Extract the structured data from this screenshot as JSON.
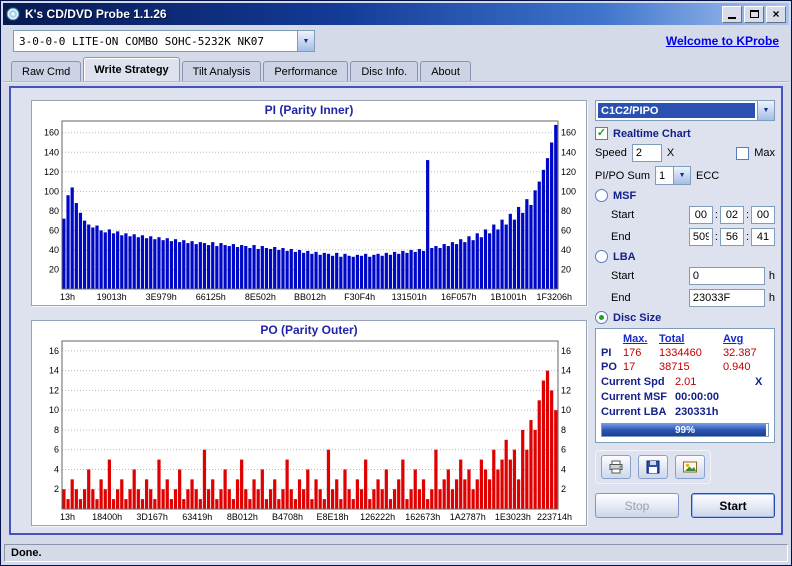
{
  "window": {
    "title": "K's CD/DVD Probe 1.1.26",
    "status": "Done."
  },
  "icons": {
    "dropdown": "▼",
    "check": "✓",
    "close": "×"
  },
  "toolbar": {
    "drive": "3-0-0-0 LITE-ON COMBO SOHC-5232K NK07",
    "link": "Welcome to KProbe"
  },
  "tabs": {
    "items": [
      "Raw Cmd",
      "Write Strategy",
      "Tilt Analysis",
      "Performance",
      "Disc Info.",
      "About"
    ],
    "active_index": 1
  },
  "controls": {
    "mode_combo": "C1C2/PIPO",
    "realtime_label": "Realtime Chart",
    "speed_label": "Speed",
    "speed_value": "2",
    "speed_unit": "X",
    "max_label": "Max",
    "sum_label": "PI/PO Sum",
    "sum_value": "1",
    "ecc_label": "ECC",
    "msf_label": "MSF",
    "lba_label": "LBA",
    "disc_label": "Disc Size",
    "start_label": "Start",
    "end_label": "End",
    "time_sep": ":",
    "msf_start": [
      "00",
      "02",
      "00"
    ],
    "msf_end": [
      "509",
      "56",
      "41"
    ],
    "lba_start": "0",
    "lba_end": "23033F",
    "lba_unit": "h",
    "states": {
      "realtime": true,
      "max": false,
      "range": "disc"
    },
    "stats": {
      "headers": [
        "Max.",
        "Total",
        "Avg"
      ],
      "rows": [
        {
          "label": "PI",
          "max": "176",
          "total": "1334460",
          "avg": "32.387"
        },
        {
          "label": "PO",
          "max": "17",
          "total": "38715",
          "avg": "0.940"
        }
      ]
    },
    "current": [
      {
        "label": "Current Spd",
        "value": "2.01",
        "suffix": "X"
      },
      {
        "label": "Current MSF",
        "value": "00:00:00",
        "suffix": ""
      },
      {
        "label": "Current LBA",
        "value": "230331h",
        "suffix": ""
      }
    ],
    "progress": {
      "percent": 99,
      "label": "99%"
    },
    "stop_label": "Stop"
  },
  "chart_data": [
    {
      "type": "bar",
      "title": "PI (Parity Inner)",
      "color": "#0008c8",
      "ylim": [
        0,
        172
      ],
      "ytick": 20,
      "grid": "dashed-horizontal",
      "x_tick_labels": [
        "13h",
        "19013h",
        "3E979h",
        "66125h",
        "8E502h",
        "BB012h",
        "F30F4h",
        "131501h",
        "16F057h",
        "1B1001h",
        "1F3206h"
      ],
      "values": [
        72,
        96,
        104,
        88,
        78,
        70,
        66,
        63,
        65,
        60,
        58,
        61,
        57,
        59,
        55,
        57,
        54,
        56,
        53,
        55,
        52,
        54,
        51,
        53,
        50,
        52,
        49,
        51,
        48,
        50,
        47,
        49,
        46,
        48,
        47,
        45,
        48,
        44,
        47,
        45,
        44,
        46,
        43,
        45,
        44,
        42,
        45,
        41,
        44,
        42,
        41,
        43,
        40,
        42,
        39,
        41,
        38,
        40,
        37,
        39,
        36,
        38,
        35,
        37,
        36,
        34,
        37,
        33,
        36,
        34,
        33,
        35,
        34,
        36,
        33,
        35,
        36,
        34,
        37,
        35,
        38,
        36,
        39,
        37,
        40,
        38,
        41,
        39,
        132,
        42,
        44,
        42,
        46,
        44,
        48,
        46,
        51,
        48,
        54,
        50,
        57,
        53,
        61,
        57,
        66,
        61,
        71,
        66,
        77,
        71,
        84,
        78,
        92,
        86,
        101,
        110,
        122,
        134,
        150,
        168
      ]
    },
    {
      "type": "bar",
      "title": "PO (Parity Outer)",
      "color": "#e00000",
      "ylim": [
        0,
        17
      ],
      "ytick": 2,
      "grid": "dashed-horizontal",
      "x_tick_labels": [
        "13h",
        "18400h",
        "3D167h",
        "63419h",
        "8B012h",
        "B4708h",
        "E8E18h",
        "126222h",
        "162673h",
        "1A2787h",
        "1E3023h",
        "223714h"
      ],
      "values": [
        2,
        1,
        3,
        2,
        1,
        2,
        4,
        2,
        1,
        3,
        2,
        5,
        1,
        2,
        3,
        1,
        2,
        4,
        2,
        1,
        3,
        2,
        1,
        5,
        2,
        3,
        1,
        2,
        4,
        1,
        2,
        3,
        2,
        1,
        6,
        2,
        3,
        1,
        2,
        4,
        2,
        1,
        3,
        5,
        2,
        1,
        3,
        2,
        4,
        1,
        2,
        3,
        1,
        2,
        5,
        2,
        1,
        3,
        2,
        4,
        1,
        3,
        2,
        1,
        6,
        2,
        3,
        1,
        4,
        2,
        1,
        3,
        2,
        5,
        1,
        2,
        3,
        2,
        4,
        1,
        2,
        3,
        5,
        1,
        2,
        4,
        2,
        3,
        1,
        2,
        6,
        2,
        3,
        4,
        2,
        3,
        5,
        3,
        4,
        2,
        3,
        5,
        4,
        3,
        6,
        4,
        5,
        7,
        5,
        6,
        3,
        8,
        6,
        9,
        8,
        11,
        13,
        14,
        12,
        10
      ]
    }
  ]
}
